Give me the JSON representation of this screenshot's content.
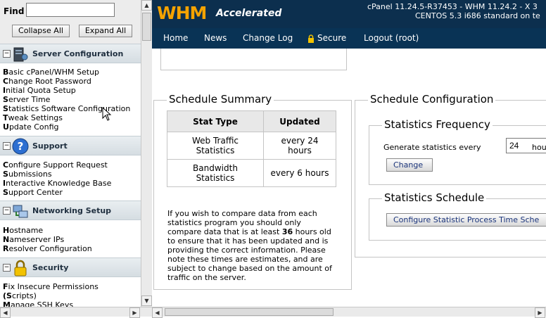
{
  "sidebar": {
    "find_label": "Find",
    "find_value": "",
    "collapse_label": "Collapse All",
    "expand_label": "Expand All",
    "sections": [
      {
        "title": "Server Configuration",
        "toggle": "−",
        "icon": "server-icon",
        "items": [
          "Basic cPanel/WHM Setup",
          "Change Root Password",
          "Initial Quota Setup",
          "Server Time",
          "Statistics Software Configuration",
          "Tweak Settings",
          "Update Config"
        ]
      },
      {
        "title": "Support",
        "toggle": "−",
        "icon": "help-icon",
        "items": [
          "Configure Support Request",
          "Submissions",
          "Interactive Knowledge Base",
          "Support Center"
        ]
      },
      {
        "title": "Networking Setup",
        "toggle": "−",
        "icon": "network-icon",
        "items": [
          "Hostname",
          "Nameserver IPs",
          "Resolver Configuration"
        ]
      },
      {
        "title": "Security",
        "toggle": "−",
        "icon": "lock-icon",
        "items": [
          "Fix Insecure Permissions",
          "(Scripts)",
          "Manage SSH Keys"
        ]
      }
    ]
  },
  "header": {
    "logo_main": "WHM",
    "logo_sub": "Accelerated",
    "version_line1": "cPanel 11.24.5-R37453 - WHM 11.24.2 - X 3",
    "version_line2": "CENTOS 5.3 i686 standard on te"
  },
  "nav": {
    "home": "Home",
    "news": "News",
    "changelog": "Change Log",
    "secure": "Secure",
    "logout": "Logout (root)"
  },
  "schedule_summary": {
    "legend": "Schedule Summary",
    "columns": [
      "Stat Type",
      "Updated"
    ],
    "rows": [
      {
        "type": [
          "Web Traffic",
          "Statistics"
        ],
        "updated": [
          "every 24",
          "hours"
        ]
      },
      {
        "type": [
          "Bandwidth",
          "Statistics"
        ],
        "updated": [
          "every 6 hours"
        ]
      }
    ],
    "info_before": "If you wish to compare data from each statistics program you should only compare data that is at least ",
    "info_bold": "36",
    "info_after": " hours old to ensure that it has been updated and is providing the correct information. Please note these times are estimates, and are subject to change based on the amount of traffic on the server."
  },
  "schedule_config": {
    "legend": "Schedule Configuration",
    "frequency": {
      "legend": "Statistics Frequency",
      "label": "Generate statistics every",
      "value": "24",
      "suffix": "hou",
      "button": "Change"
    },
    "schedule": {
      "legend": "Statistics Schedule",
      "button": "Configure Statistic Process Time Sche"
    }
  },
  "colors": {
    "header_bg": "#0c2f4e",
    "logo_orange": "#f5a300",
    "button_text": "#19337a"
  }
}
